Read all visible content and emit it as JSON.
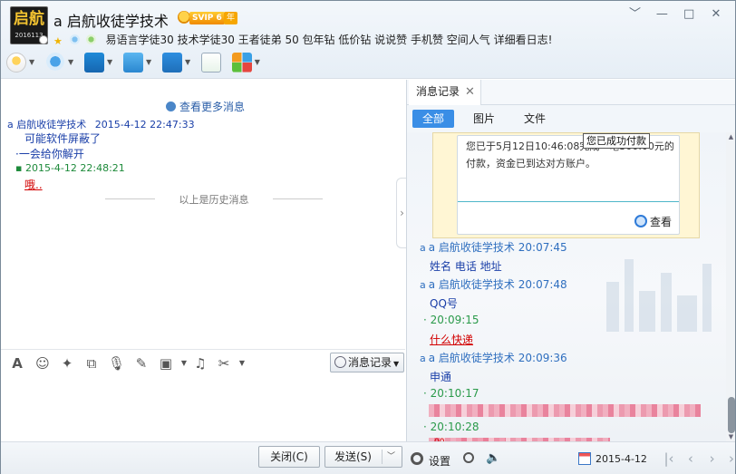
{
  "header": {
    "contact_name": "a 启航收徒学技术",
    "avatar_text": "启航",
    "avatar_sub": "2016113",
    "vip_label": "SVIP 6",
    "vip_year_label": "年",
    "signature": "易语言学徒30 技术学徒30 王者徒弟 50 包年钻 低价钻  说说赞 手机赞 空间人气 详细看日志!",
    "window_controls": [
      "﹀",
      "—",
      "□",
      "✕"
    ]
  },
  "chat": {
    "more_messages": "查看更多消息",
    "messages": [
      {
        "sender": "a 启航收徒学技术",
        "time": "2015-4-12 22:47:33"
      },
      {
        "text": "可能软件屏蔽了"
      },
      {
        "text": "一会给你解开"
      },
      {
        "time": "2015-4-12 22:48:21"
      },
      {
        "text": "哦.."
      }
    ],
    "history_divider": "以上是历史消息"
  },
  "input_toolbar": {
    "msg_record_label": "消息记录"
  },
  "buttons": {
    "close_label": "关闭(C)",
    "send_label": "发送(S)"
  },
  "history_panel": {
    "tab_label": "消息记录",
    "filters": [
      "全部",
      "图片",
      "文件"
    ],
    "card_text": "您已于5月12日10:46:08完成一笔300.00元的付款，资金已到达对方账户。",
    "card_view_label": "查看",
    "tooltip": "您已成功付款",
    "entries": [
      {
        "sender": "a 启航收徒学技术",
        "time": "20:07:45"
      },
      {
        "text": "姓名 电话 地址"
      },
      {
        "sender": "a 启航收徒学技术",
        "time": "20:07:48"
      },
      {
        "text": "QQ号"
      },
      {
        "time": "20:09:15"
      },
      {
        "text": "什么快递"
      },
      {
        "sender": "a 启航收徒学技术",
        "time": "20:09:36"
      },
      {
        "text": "申通"
      },
      {
        "time": "20:10:17"
      },
      {
        "time": "20:10:28"
      },
      {
        "text": "00"
      }
    ],
    "settings_label": "设置",
    "date": "2015-4-12"
  }
}
